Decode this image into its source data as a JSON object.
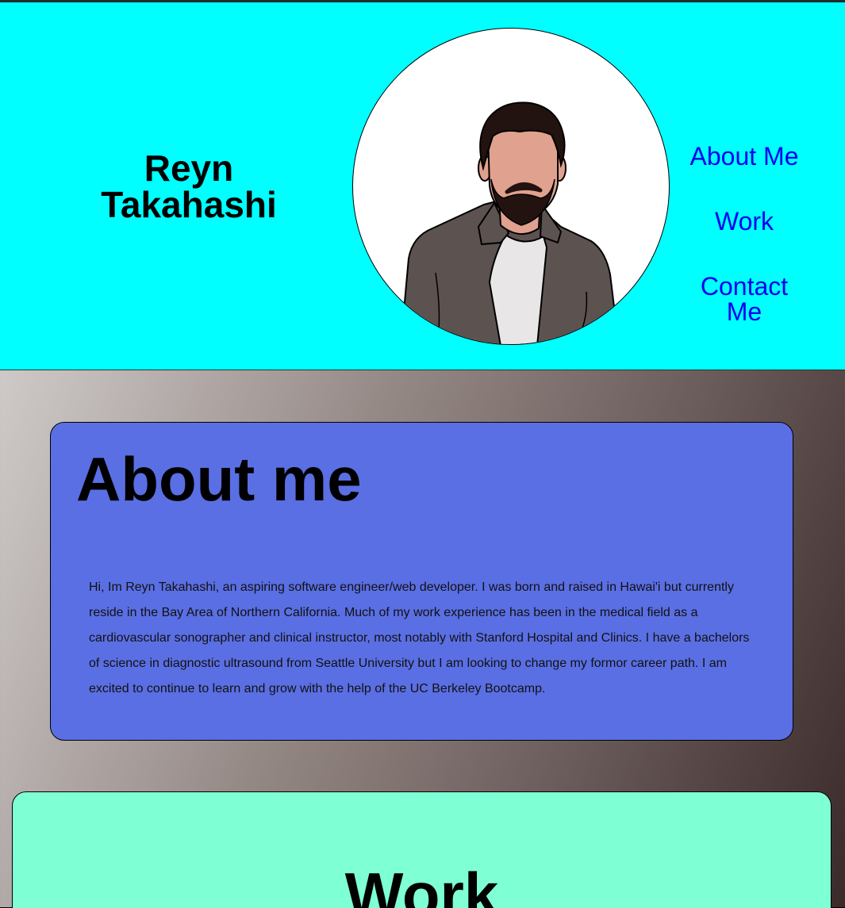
{
  "header": {
    "name": "Reyn Takahashi",
    "portrait_icon": "portrait-illustration",
    "nav": [
      {
        "label": "About Me"
      },
      {
        "label": "Work"
      },
      {
        "label": "Contact Me"
      }
    ]
  },
  "about": {
    "title": "About me",
    "text": "Hi, Im Reyn Takahashi, an aspiring software engineer/web developer. I was born and raised in Hawai'i but currently reside in the Bay Area of Northern California. Much of my work experience has been in the medical field as a cardiovascular sonographer and clinical instructor, most notably with Stanford Hospital and Clinics. I have a bachelors of science in diagnostic ultrasound from Seattle University but I am looking to change my formor career path. I am excited to continue to learn and grow with the help of the UC Berkeley Bootcamp."
  },
  "work": {
    "title": "Work"
  },
  "colors": {
    "header_bg": "#00ffff",
    "about_bg": "#5a6fe3",
    "work_bg": "#7fffd4",
    "link": "#0000ee"
  }
}
